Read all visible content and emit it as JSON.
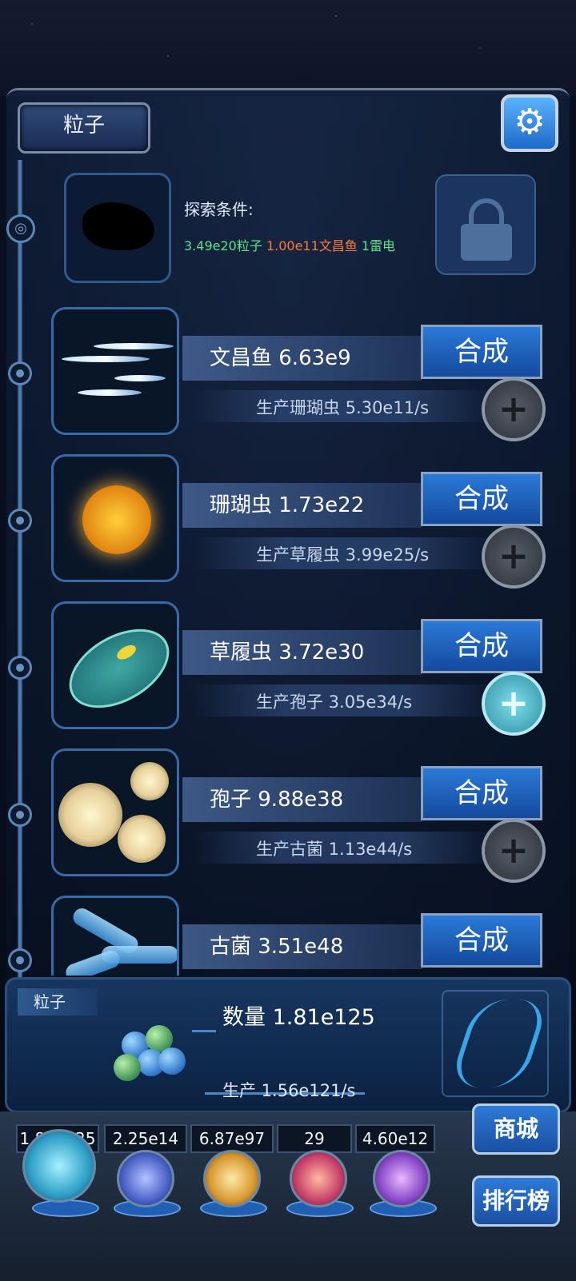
{
  "header": {
    "tab_label": "粒子"
  },
  "explore": {
    "label": "探索条件:",
    "cond_particle": "3.49e20粒子",
    "cond_fish": "1.00e11文昌鱼",
    "cond_thunder": "1雷电"
  },
  "creatures": [
    {
      "name": "文昌鱼 6.63e9",
      "rate": "生产珊瑚虫 5.30e11/s",
      "craft": "合成"
    },
    {
      "name": "珊瑚虫 1.73e22",
      "rate": "生产草履虫 3.99e25/s",
      "craft": "合成"
    },
    {
      "name": "草履虫 3.72e30",
      "rate": "生产孢子 3.05e34/s",
      "craft": "合成"
    },
    {
      "name": "孢子 9.88e38",
      "rate": "生产古菌 1.13e44/s",
      "craft": "合成"
    },
    {
      "name": "古菌 3.51e48",
      "rate": "",
      "craft": "合成"
    }
  ],
  "info": {
    "tab": "粒子",
    "quantity": "数量 1.81e125",
    "production": "生产 1.56e121/s"
  },
  "resources": [
    {
      "value": "1.81e125",
      "orb": "particle-orb",
      "color": "#2fa0c8"
    },
    {
      "value": "2.25e14",
      "orb": "lightning-orb",
      "color": "#4b62c8"
    },
    {
      "value": "6.87e97",
      "orb": "galaxy-orb",
      "color": "#d89a30"
    },
    {
      "value": "29",
      "orb": "brain-orb",
      "color": "#c8406a"
    },
    {
      "value": "4.60e12",
      "orb": "vortex-orb",
      "color": "#8a48c8"
    }
  ],
  "side": {
    "shop": "商城",
    "rank": "排行榜"
  },
  "colors": {
    "accent": "#2a79d8",
    "green": "#5fe38a",
    "orange": "#ff7a3a"
  }
}
